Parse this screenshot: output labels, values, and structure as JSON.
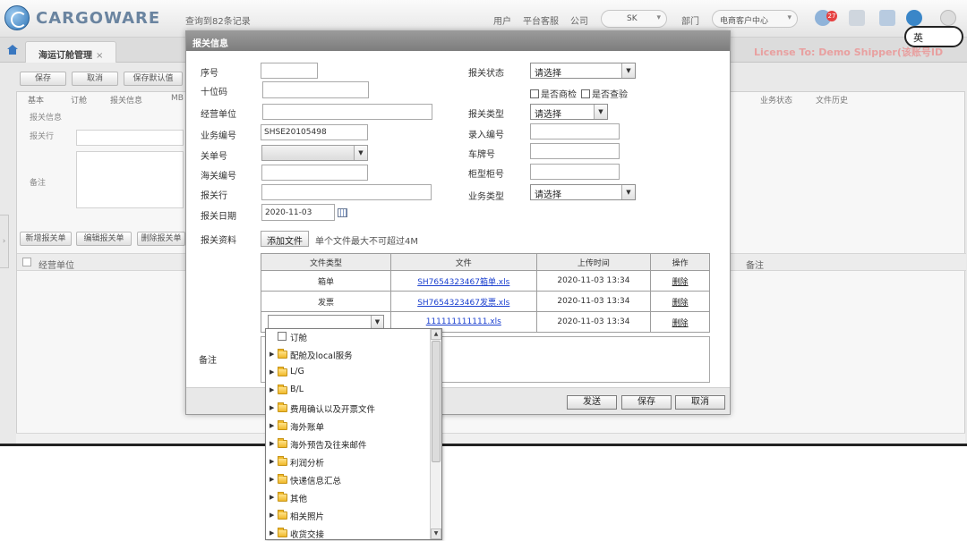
{
  "app": {
    "logo": "CARGOWARE",
    "query_records": "查询到82条记录",
    "top_links": [
      "用户",
      "平台客服",
      "公司",
      "部门"
    ],
    "company_select": "SK",
    "dept_select": "电商客户中心",
    "notification_count": "27",
    "page_tab": "海运订舱管理",
    "license": "License To: Demo Shipper(该账号ID",
    "toolbar": [
      "保存",
      "取消",
      "保存默认值"
    ],
    "sub_tabs": [
      "基本",
      "订舱",
      "报关信息",
      "MB"
    ],
    "sub_tabs_right": [
      "业务状态",
      "文件历史"
    ],
    "section_title": "报关信息",
    "bg_labels": [
      "报关行",
      "备注"
    ],
    "bg_buttons": [
      "新增报关单",
      "编辑报关单",
      "删除报关单"
    ],
    "grid_columns": [
      "经营单位",
      "备注"
    ]
  },
  "modal": {
    "title": "报关信息",
    "fields": {
      "seq_label": "序号",
      "code10_label": "十位码",
      "operator_label": "经营单位",
      "bizno_label": "业务编号",
      "bizno_value": "SHSE20105498",
      "customs_no_label": "关单号",
      "customs_code_label": "海关编号",
      "broker_label": "报关行",
      "date_label": "报关日期",
      "date_value": "2020-11-03",
      "attachments_label": "报关资料",
      "add_file": "添加文件",
      "file_hint": "单个文件最大不可超过4M",
      "status_label": "报关状态",
      "status_value": "请选择",
      "check_inspection": "是否商检",
      "check_quarantine": "是否查验",
      "type_label": "报关类型",
      "type_value": "请选择",
      "entry_no_label": "录入编号",
      "plate_label": "车牌号",
      "container_label": "柜型柜号",
      "biz_type_label": "业务类型",
      "biz_type_value": "请选择",
      "remark_label": "备注"
    },
    "files_table": {
      "headers": [
        "文件类型",
        "文件",
        "上传时间",
        "操作"
      ],
      "rows": [
        {
          "type": "箱单",
          "file": "SH7654323467箱单.xls",
          "time": "2020-11-03 13:34",
          "action": "删除"
        },
        {
          "type": "发票",
          "file": "SH7654323467发票.xls",
          "time": "2020-11-03 13:34",
          "action": "删除"
        },
        {
          "type": "",
          "file": "111111111111.xls",
          "time": "2020-11-03 13:34",
          "action": "删除"
        }
      ]
    },
    "buttons": {
      "send": "发送",
      "save": "保存",
      "cancel": "取消"
    }
  },
  "dropdown": {
    "items": [
      "订舱",
      "配舱及local服务",
      "L/G",
      "B/L",
      "费用确认以及开票文件",
      "海外账单",
      "海外预告及往来邮件",
      "利润分析",
      "快递信息汇总",
      "其他",
      "相关照片",
      "收货交接"
    ]
  },
  "ime": "英"
}
